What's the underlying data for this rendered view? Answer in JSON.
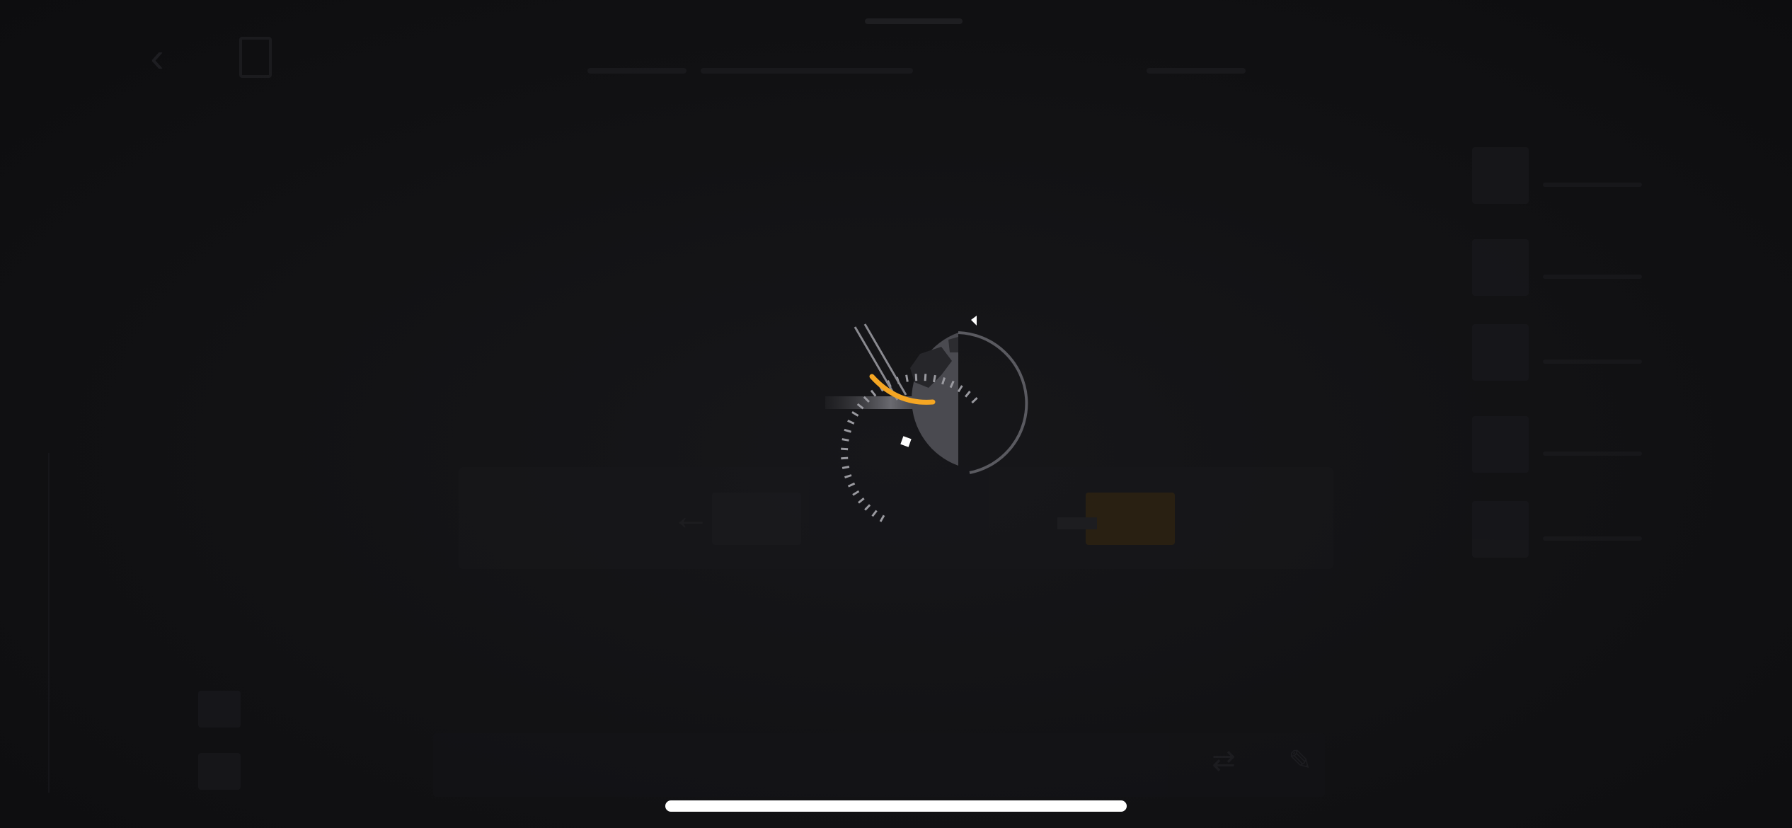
{
  "app": {
    "state": "loading",
    "accent_color": "#f5a623",
    "background_color": "#121214"
  },
  "top_bar": {
    "back_icon": "chevron-left-icon",
    "bookmark_icon": "bookmark-icon"
  },
  "loading_indicator": {
    "icon": "globe-spinner-icon",
    "progress": 0.28
  },
  "home_indicator": {
    "color": "#ffffff"
  }
}
